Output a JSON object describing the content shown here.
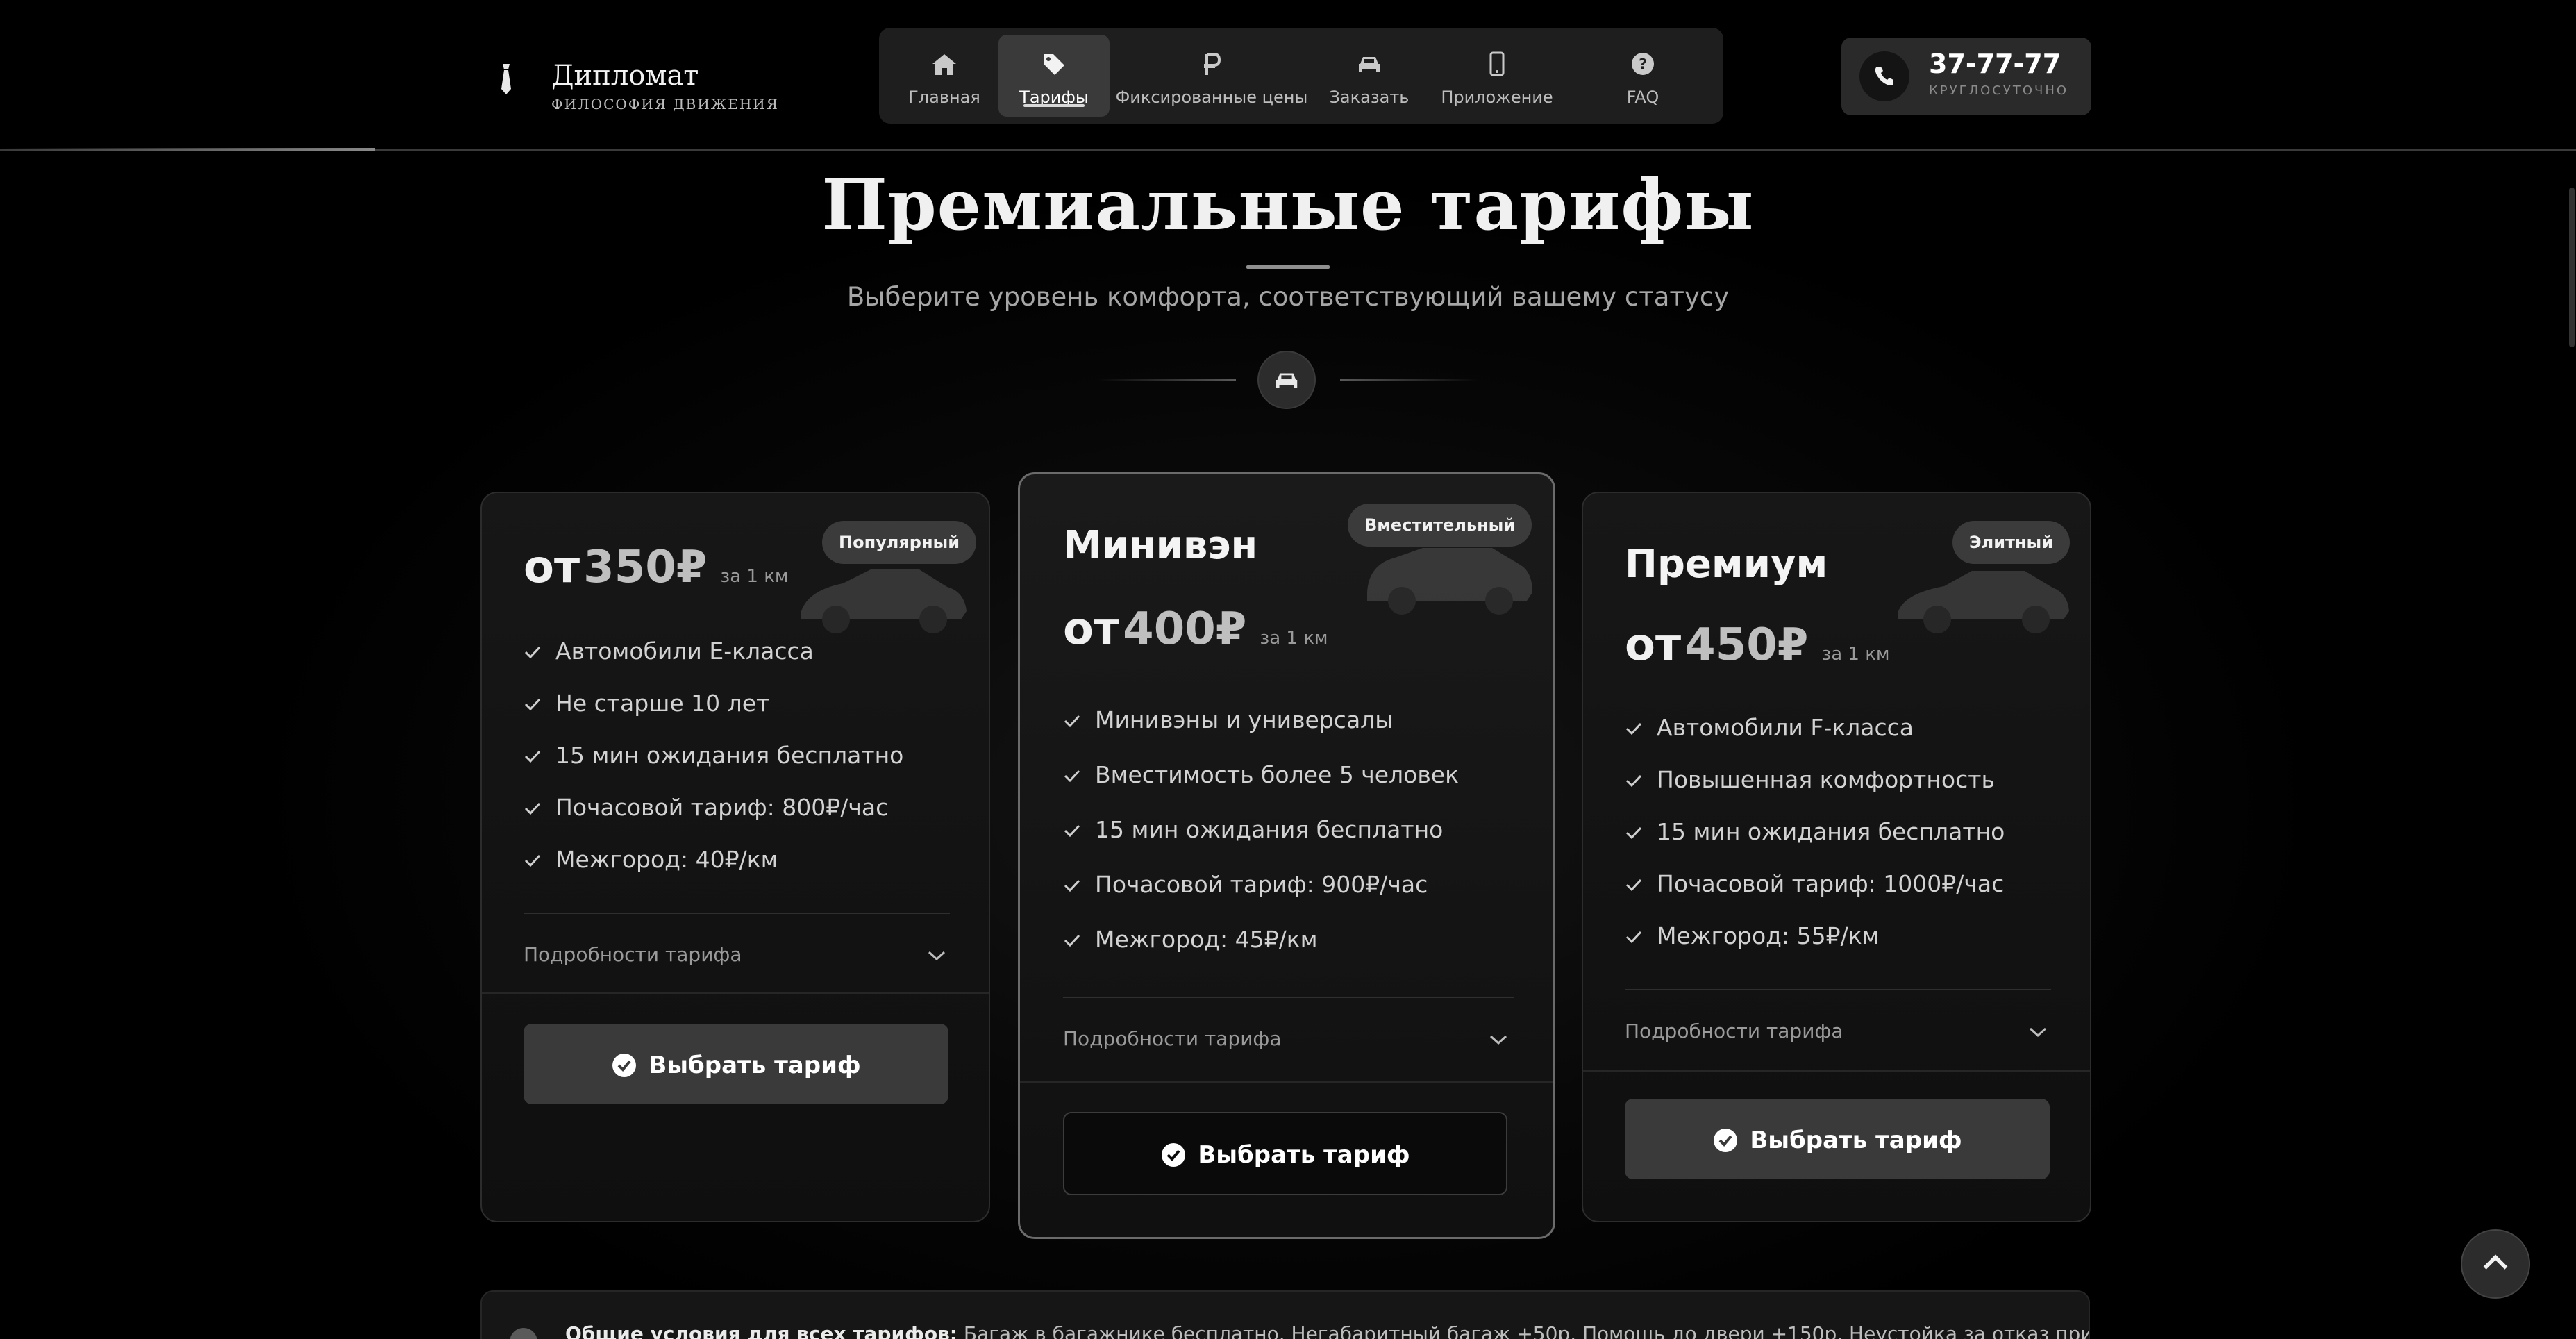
{
  "brand": {
    "title": "Дипломат",
    "subtitle": "ФИЛОСОФИЯ ДВИЖЕНИЯ"
  },
  "nav": [
    {
      "label": "Главная",
      "icon": "home-icon"
    },
    {
      "label": "Тарифы",
      "icon": "tag-icon",
      "active": true
    },
    {
      "label": "Фиксированные цены",
      "icon": "ruble-icon"
    },
    {
      "label": "Заказать",
      "icon": "car-icon"
    },
    {
      "label": "Приложение",
      "icon": "mobile-icon"
    },
    {
      "label": "FAQ",
      "icon": "question-icon"
    }
  ],
  "phone": {
    "number": "37-77-77",
    "caption": "КРУГЛОСУТОЧНО"
  },
  "hero": {
    "title": "Премиальные тарифы",
    "subtitle": "Выберите уровень комфорта, соответствующий вашему статусу"
  },
  "cards": [
    {
      "badge": "Популярный",
      "price_prefix": "от",
      "price": "350₽",
      "unit": "за 1 км",
      "features": [
        "Автомобили Е-класса",
        "Не старше 10 лет",
        "15 мин ожидания бесплатно",
        "Почасовой тариф: 800₽/час",
        "Межгород: 40₽/км"
      ],
      "details": "Подробности тарифа",
      "button": "Выбрать тариф"
    },
    {
      "badge": "Вместительный",
      "name": "Минивэн",
      "price_prefix": "от",
      "price": "400₽",
      "unit": "за 1 км",
      "features": [
        "Минивэны и универсалы",
        "Вместимость более 5 человек",
        "15 мин ожидания бесплатно",
        "Почасовой тариф: 900₽/час",
        "Межгород: 45₽/км"
      ],
      "details": "Подробности тарифа",
      "button": "Выбрать тариф"
    },
    {
      "badge": "Элитный",
      "name": "Премиум",
      "price_prefix": "от",
      "price": "450₽",
      "unit": "за 1 км",
      "features": [
        "Автомобили F-класса",
        "Повышенная комфортность",
        "15 мин ожидания бесплатно",
        "Почасовой тариф: 1000₽/час",
        "Межгород: 55₽/км"
      ],
      "details": "Подробности тарифа",
      "button": "Выбрать тариф"
    }
  ],
  "conditions": {
    "label": "Общие условия для всех тарифов:",
    "text": "Багаж в багажнике бесплатно. Негабаритный багаж +50р. Помощь до двери +150р. Неустойка за отказ при ожидании..."
  },
  "colors": {
    "background": "#000000",
    "card": "#151515",
    "accent": "#3a3a3a",
    "text": "#e8e8e8"
  }
}
